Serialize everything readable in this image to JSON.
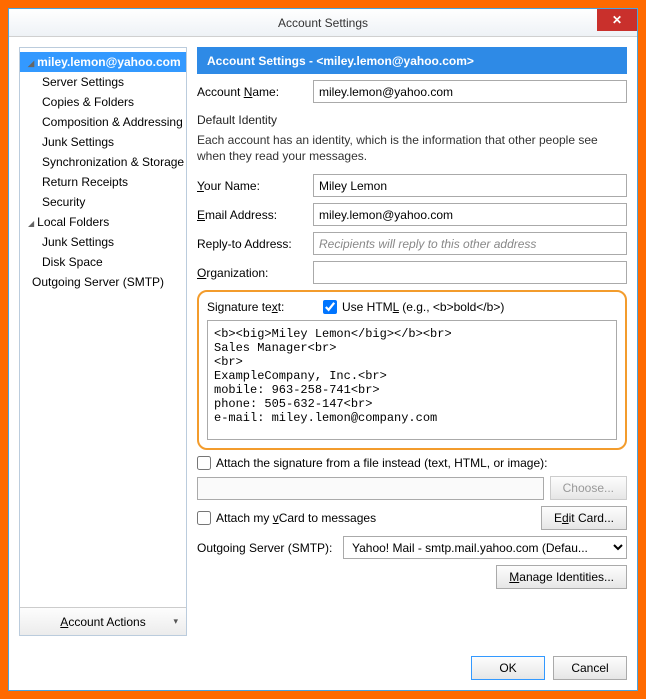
{
  "window": {
    "title": "Account Settings",
    "close": "✕"
  },
  "sidebar": {
    "root1": "miley.lemon@yahoo.com",
    "items1": [
      "Server Settings",
      "Copies & Folders",
      "Composition & Addressing",
      "Junk Settings",
      "Synchronization & Storage",
      "Return Receipts",
      "Security"
    ],
    "root2": "Local Folders",
    "items2": [
      "Junk Settings",
      "Disk Space"
    ],
    "outgoing": "Outgoing Server (SMTP)",
    "actions_label": "Account Actions"
  },
  "header": {
    "prefix": "Account Settings - ",
    "account": "<miley.lemon@yahoo.com>"
  },
  "account_name": {
    "label": "Account Name:",
    "value": "miley.lemon@yahoo.com"
  },
  "identity": {
    "title": "Default Identity",
    "desc": "Each account has an identity, which is the information that other people see when they read your messages.",
    "your_name_label": "Your Name:",
    "your_name_value": "Miley Lemon",
    "email_label": "Email Address:",
    "email_value": "miley.lemon@yahoo.com",
    "reply_label": "Reply-to Address:",
    "reply_placeholder": "Recipients will reply to this other address",
    "org_label": "Organization:",
    "org_value": ""
  },
  "signature": {
    "label": "Signature text:",
    "use_html_label": "Use HTML (e.g., <b>bold</b>)",
    "use_html_checked": true,
    "text": "<b><big>Miley Lemon</big></b><br>\nSales Manager<br>\n<br>\nExampleCompany, Inc.<br>\nmobile: 963-258-741<br>\nphone: 505-632-147<br>\ne-mail: miley.lemon@company.com"
  },
  "attach_file": {
    "label": "Attach the signature from a file instead (text, HTML, or image):",
    "choose": "Choose..."
  },
  "vcard": {
    "label": "Attach my vCard to messages",
    "edit": "Edit Card..."
  },
  "smtp": {
    "label": "Outgoing Server (SMTP):",
    "value": "Yahoo! Mail - smtp.mail.yahoo.com (Defau..."
  },
  "manage": "Manage Identities...",
  "footer": {
    "ok": "OK",
    "cancel": "Cancel"
  }
}
